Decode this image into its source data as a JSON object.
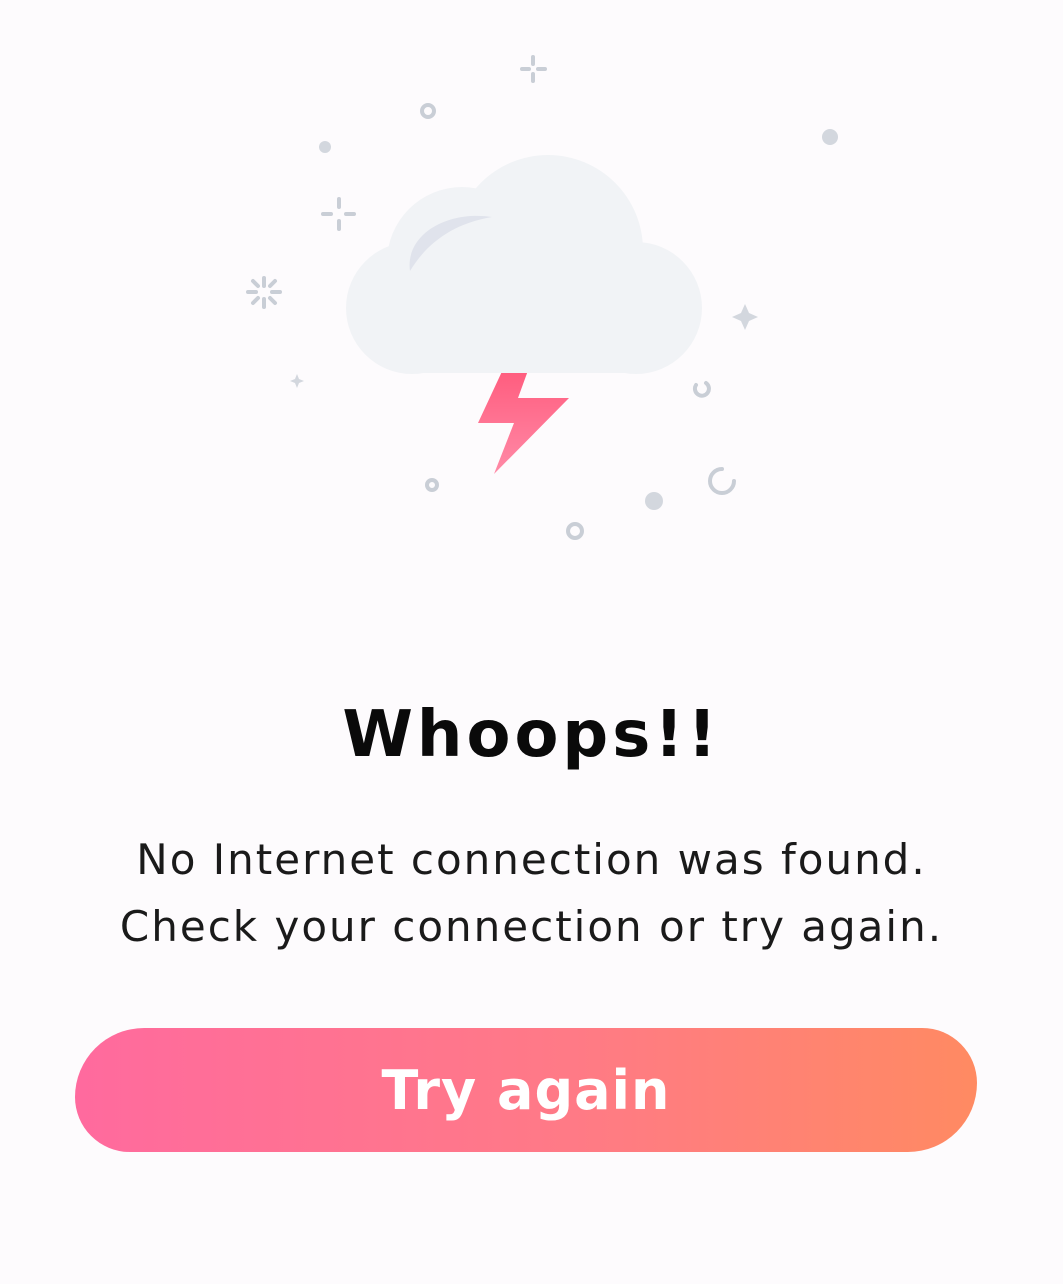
{
  "error": {
    "illustration_icon": "storm-cloud-lightning-icon",
    "title": "Whoops!!",
    "message": "No Internet connection was found. Check your connection or try again.",
    "retry_label": "Try again"
  },
  "colors": {
    "background": "#fdfbfd",
    "cloud": "#f1f3f6",
    "cloud_shade": "#e0e3ec",
    "sparkle": "#c9ced6",
    "lightning_top": "#ff5a7c",
    "lightning_bottom": "#ff8aa7",
    "button_gradient_start": "#ff6a9e",
    "button_gradient_end": "#ff8a62",
    "text_primary": "#0a0a0a"
  }
}
